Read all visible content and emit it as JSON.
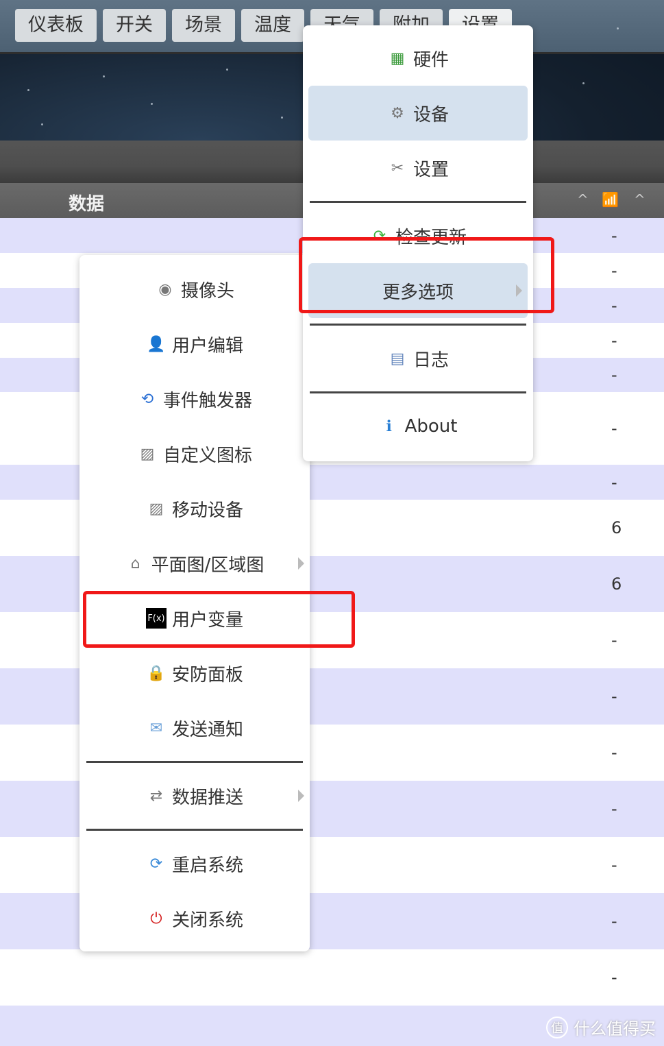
{
  "nav": {
    "items": [
      "仪表板",
      "开关",
      "场景",
      "温度",
      "天气",
      "附加",
      "设置"
    ]
  },
  "section": {
    "title": "数据"
  },
  "rows": [
    "-",
    "-",
    "-",
    "-",
    "-",
    "-",
    "-",
    "6",
    "6",
    "-",
    "-",
    "-",
    "-",
    "-",
    "-",
    "-",
    ""
  ],
  "settings_menu": {
    "items": [
      {
        "label": "硬件",
        "icon": "hardware-icon"
      },
      {
        "label": "设备",
        "icon": "gear-icon"
      },
      {
        "label": "设置",
        "icon": "tools-icon"
      },
      {
        "label": "检查更新",
        "icon": "update-icon"
      },
      {
        "label": "更多选项",
        "icon": ""
      },
      {
        "label": "日志",
        "icon": "log-icon"
      },
      {
        "label": "About",
        "icon": "info-icon"
      }
    ]
  },
  "more_menu": {
    "items": [
      {
        "label": "摄像头",
        "icon": "camera-icon"
      },
      {
        "label": "用户编辑",
        "icon": "user-icon"
      },
      {
        "label": "事件触发器",
        "icon": "event-icon"
      },
      {
        "label": "自定义图标",
        "icon": "custom-icon"
      },
      {
        "label": "移动设备",
        "icon": "mobile-icon"
      },
      {
        "label": "平面图/区域图",
        "icon": "floorplan-icon"
      },
      {
        "label": "用户变量",
        "icon": "fx-icon"
      },
      {
        "label": "安防面板",
        "icon": "lock-icon"
      },
      {
        "label": "发送通知",
        "icon": "mail-icon"
      },
      {
        "label": "数据推送",
        "icon": "push-icon"
      },
      {
        "label": "重启系统",
        "icon": "restart-icon"
      },
      {
        "label": "关闭系统",
        "icon": "shutdown-icon"
      }
    ]
  },
  "watermark": {
    "icon_text": "值",
    "text": "什么值得买"
  }
}
